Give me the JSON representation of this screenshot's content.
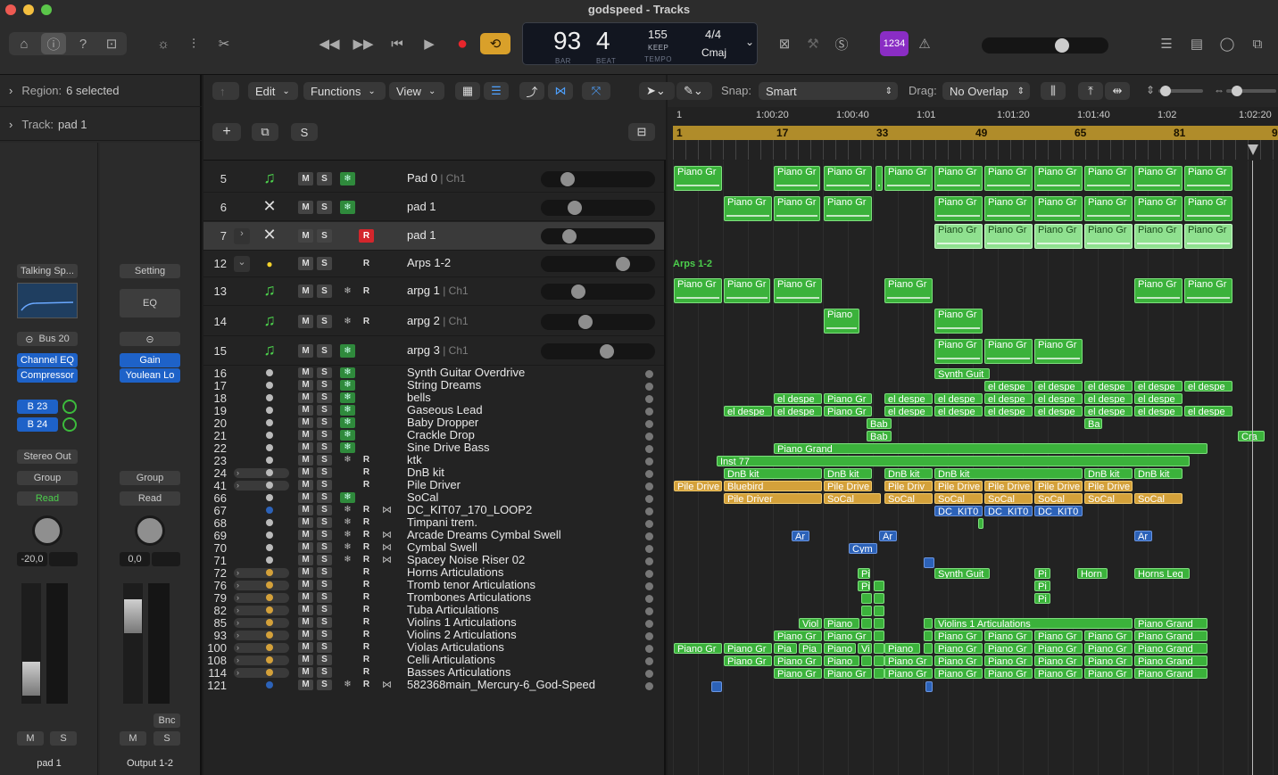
{
  "window": {
    "title": "godspeed - Tracks"
  },
  "lcd": {
    "bar": "93",
    "beat": "4",
    "bar_label": "BAR",
    "beat_label": "BEAT",
    "tempo": "155",
    "keep": "KEEP",
    "tempo_label": "TEMPO",
    "signature": "4/4",
    "key": "Cmaj"
  },
  "count_in": "1234",
  "inspector": {
    "region_label": "Region:",
    "region_value": "6 selected",
    "track_label": "Track:",
    "track_value": "pad 1",
    "left_strip": {
      "preset": "Talking Sp...",
      "io": "Bus 20",
      "plugins": [
        "Channel EQ",
        "Compressor"
      ],
      "sends": [
        "B 23",
        "B 24"
      ],
      "output": "Stereo Out",
      "group": "Group",
      "automation": "Read",
      "volume": "-20,0",
      "m": "M",
      "s": "S",
      "name": "pad 1"
    },
    "right_strip": {
      "preset": "Setting",
      "eq": "EQ",
      "plugins": [
        "Gain",
        "Youlean Lo"
      ],
      "group": "Group",
      "automation": "Read",
      "volume": "0,0",
      "bnc": "Bnc",
      "m": "M",
      "s": "S",
      "name": "Output 1-2"
    }
  },
  "menus": {
    "edit": "Edit",
    "functions": "Functions",
    "view": "View",
    "snap_label": "Snap:",
    "snap_value": "Smart",
    "drag_label": "Drag:",
    "drag_value": "No Overlap",
    "solo": "S",
    "add": "+"
  },
  "ruler": {
    "times": [
      "1",
      "1:00:20",
      "1:00:40",
      "1:01",
      "1:01:20",
      "1:01:40",
      "1:02",
      "1:02:20"
    ],
    "bars": [
      "1",
      "17",
      "33",
      "49",
      "65",
      "81",
      "9"
    ]
  },
  "tracks": [
    {
      "num": "5",
      "name": "Pad 0",
      "ch": "| Ch1"
    },
    {
      "num": "6",
      "name": "pad 1",
      "ch": ""
    },
    {
      "num": "7",
      "name": "pad 1",
      "ch": ""
    },
    {
      "num": "12",
      "name": "Arps 1-2",
      "ch": ""
    },
    {
      "num": "13",
      "name": "arpg 1",
      "ch": "| Ch1"
    },
    {
      "num": "14",
      "name": "arpg 2",
      "ch": "| Ch1"
    },
    {
      "num": "15",
      "name": "arpg 3",
      "ch": "| Ch1"
    },
    {
      "num": "16",
      "name": "Synth Guitar Overdrive"
    },
    {
      "num": "17",
      "name": "String Dreams"
    },
    {
      "num": "18",
      "name": "bells"
    },
    {
      "num": "19",
      "name": "Gaseous Lead"
    },
    {
      "num": "20",
      "name": "Baby Dropper"
    },
    {
      "num": "21",
      "name": "Crackle Drop"
    },
    {
      "num": "22",
      "name": "Sine Drive Bass"
    },
    {
      "num": "23",
      "name": "ktk"
    },
    {
      "num": "24",
      "name": "DnB kit"
    },
    {
      "num": "41",
      "name": "Pile Driver"
    },
    {
      "num": "66",
      "name": "SoCal"
    },
    {
      "num": "67",
      "name": "DC_KIT07_170_LOOP2"
    },
    {
      "num": "68",
      "name": "Timpani trem."
    },
    {
      "num": "69",
      "name": "Arcade Dreams Cymbal Swell"
    },
    {
      "num": "70",
      "name": "Cymbal Swell"
    },
    {
      "num": "71",
      "name": "Spacey Noise Riser 02"
    },
    {
      "num": "72",
      "name": "Horns Articulations"
    },
    {
      "num": "76",
      "name": "Tromb tenor Articulations"
    },
    {
      "num": "79",
      "name": "Trombones Articulations"
    },
    {
      "num": "82",
      "name": "Tuba Articulations"
    },
    {
      "num": "85",
      "name": "Violins 1 Articulations"
    },
    {
      "num": "93",
      "name": "Violins 2 Articulations"
    },
    {
      "num": "100",
      "name": "Violas Articulations"
    },
    {
      "num": "108",
      "name": "Celli Articulations"
    },
    {
      "num": "114",
      "name": "Basses Articulations"
    },
    {
      "num": "121",
      "name": "582368main_Mercury-6_God-Speed"
    }
  ],
  "folder_label": "Arps 1-2",
  "clip_text": {
    "piano": "Piano Gr",
    "piano_short": "Piano",
    "synth": "Synth Guit",
    "despe": "el despe",
    "bab": "Bab",
    "ba": "Ba",
    "cra": "Cra",
    "grand": "Piano Grand",
    "inst": "Inst 77",
    "dnb": "DnB kit",
    "pile": "Pile Drive",
    "pile2": "Pile Driv",
    "pile3": "Pile Driver",
    "bluebird": "Bluebird",
    "socal": "SoCal",
    "dckit": "DC_KIT0",
    "ar": "Ar",
    "cym": "Cym",
    "pi": "Pi",
    "horn": "Horn",
    "hornsleg": "Horns Leg",
    "viol": "Viol",
    "vi": "Vi",
    "pia": "Pia",
    "violins": "Violins 1 Articulations"
  }
}
